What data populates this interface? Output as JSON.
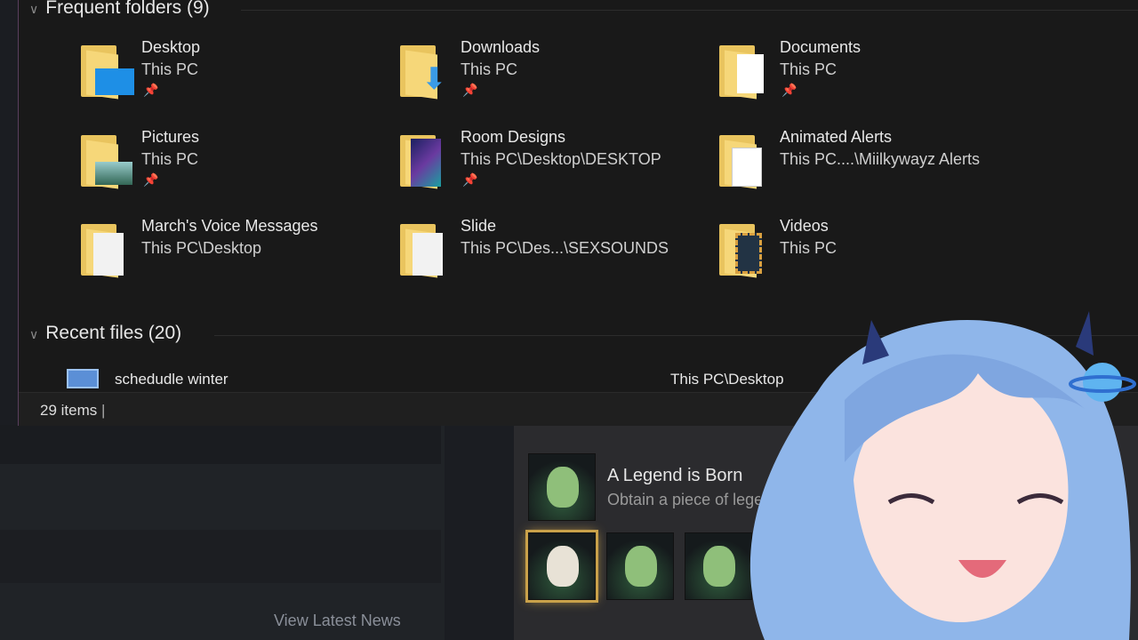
{
  "explorer": {
    "frequent_header": "Frequent folders (9)",
    "folders": [
      {
        "name": "Desktop",
        "path": "This PC",
        "pinned": true,
        "icon": "desktop-folder-icon"
      },
      {
        "name": "Downloads",
        "path": "This PC",
        "pinned": true,
        "icon": "downloads-folder-icon"
      },
      {
        "name": "Documents",
        "path": "This PC",
        "pinned": true,
        "icon": "documents-folder-icon"
      },
      {
        "name": "Pictures",
        "path": "This PC",
        "pinned": true,
        "icon": "pictures-folder-icon"
      },
      {
        "name": "Room Designs",
        "path": "This PC\\Desktop\\DESKTOP",
        "pinned": true,
        "icon": "image-folder-icon"
      },
      {
        "name": "Animated Alerts",
        "path": "This PC....\\Miilkywayz Alerts",
        "pinned": false,
        "icon": "folder-icon"
      },
      {
        "name": "March's Voice Messages",
        "path": "This PC\\Desktop",
        "pinned": false,
        "icon": "audio-folder-icon"
      },
      {
        "name": "Slide",
        "path": "This PC\\Des...\\SEXSOUNDS",
        "pinned": false,
        "icon": "audio-folder-icon"
      },
      {
        "name": "Videos",
        "path": "This PC",
        "pinned": false,
        "icon": "videos-folder-icon"
      }
    ],
    "recent_header": "Recent files (20)",
    "recent_files": [
      {
        "name": "schedudle winter",
        "location": "This PC\\Desktop"
      }
    ],
    "status": "29 items"
  },
  "background": {
    "news_link": "View Latest News",
    "achievement_title": "A Legend is Born",
    "achievement_desc": "Obtain a piece of legendary"
  }
}
